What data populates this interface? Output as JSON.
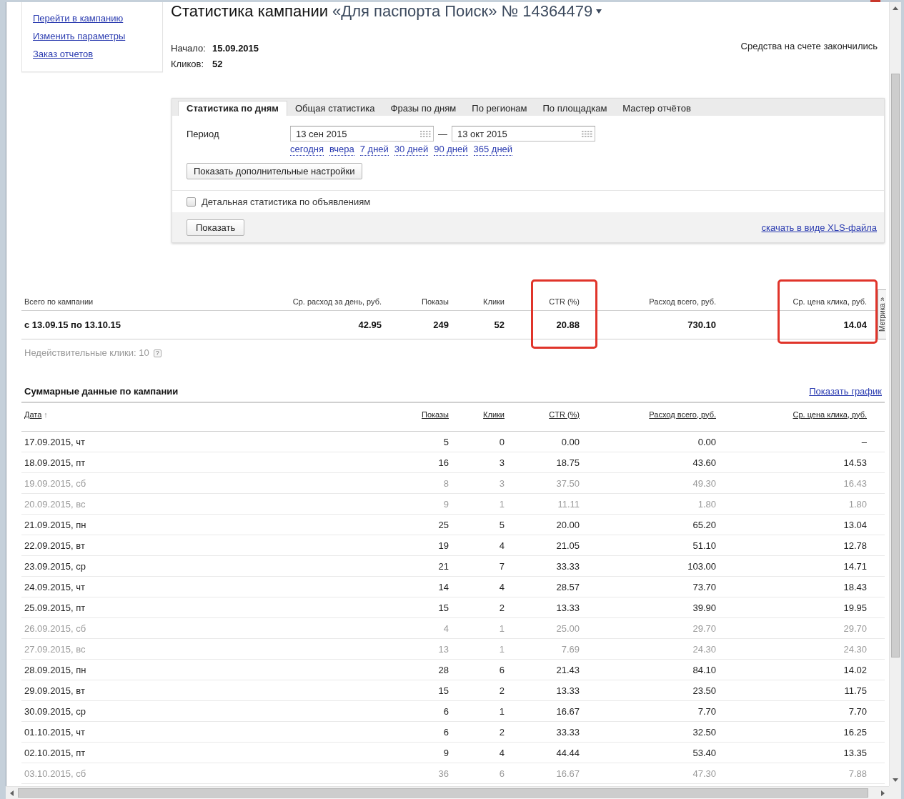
{
  "sidebar": {
    "links": [
      "Перейти в кампанию",
      "Изменить параметры",
      "Заказ отчетов"
    ]
  },
  "header": {
    "title": "Статистика кампании",
    "campaign": "«Для паспорта Поиск» № 14364479",
    "info": [
      {
        "label": "Начало:",
        "value": "15.09.2015"
      },
      {
        "label": "Кликов:",
        "value": "52"
      }
    ],
    "notice": "Средства на счете закончились"
  },
  "filter": {
    "tabs": [
      {
        "label": "Статистика по дням",
        "selected": true
      },
      {
        "label": "Общая статистика",
        "selected": false
      },
      {
        "label": "Фразы по дням",
        "selected": false
      },
      {
        "label": "По регионам",
        "selected": false
      },
      {
        "label": "По площадкам",
        "selected": false
      },
      {
        "label": "Мастер отчётов",
        "selected": false
      }
    ],
    "period_label": "Период",
    "date_from": "13 сен 2015",
    "separator": "—",
    "date_to": "13 окт 2015",
    "presets": [
      "сегодня",
      "вчера",
      "7 дней",
      "30 дней",
      "90 дней",
      "365 дней"
    ],
    "more_settings_button": "Показать дополнительные настройки",
    "detail_checkbox": {
      "label": "Детальная статистика по объявлениям",
      "checked": false
    },
    "show_button": "Показать",
    "download_link": "скачать в виде XLS-файла"
  },
  "summary": {
    "columns": [
      {
        "label": "Всего по кампании",
        "value": "с 13.09.15 по 13.10.15",
        "highlighted": false
      },
      {
        "label": "Ср. расход за день, руб.",
        "value": "42.95",
        "highlighted": false
      },
      {
        "label": "Показы",
        "value": "249",
        "highlighted": false
      },
      {
        "label": "Клики",
        "value": "52",
        "highlighted": false
      },
      {
        "label": "CTR (%)",
        "value": "20.88",
        "highlighted": true
      },
      {
        "label": "Расход всего, руб.",
        "value": "730.10",
        "highlighted": false
      },
      {
        "label": "Ср. цена клика, руб.",
        "value": "14.04",
        "highlighted": true
      }
    ],
    "side_tab": "Метрика »",
    "invalid_clicks": {
      "text": "Недействительные клики: 10",
      "help": "?"
    }
  },
  "daily": {
    "title": "Суммарные данные по кампании",
    "chart_link": "Показать график",
    "columns": [
      {
        "label": "Дата",
        "sort_arrow": "↑"
      },
      {
        "label": "Показы"
      },
      {
        "label": "Клики"
      },
      {
        "label": "CTR (%)"
      },
      {
        "label": "Расход всего, руб."
      },
      {
        "label": "Ср. цена клика, руб."
      }
    ],
    "rows": [
      {
        "cells": [
          "17.09.2015, чт",
          "5",
          "0",
          "0.00",
          "0.00",
          "–"
        ],
        "dimmed": false
      },
      {
        "cells": [
          "18.09.2015, пт",
          "16",
          "3",
          "18.75",
          "43.60",
          "14.53"
        ],
        "dimmed": false
      },
      {
        "cells": [
          "19.09.2015, сб",
          "8",
          "3",
          "37.50",
          "49.30",
          "16.43"
        ],
        "dimmed": true
      },
      {
        "cells": [
          "20.09.2015, вс",
          "9",
          "1",
          "11.11",
          "1.80",
          "1.80"
        ],
        "dimmed": true
      },
      {
        "cells": [
          "21.09.2015, пн",
          "25",
          "5",
          "20.00",
          "65.20",
          "13.04"
        ],
        "dimmed": false
      },
      {
        "cells": [
          "22.09.2015, вт",
          "19",
          "4",
          "21.05",
          "51.10",
          "12.78"
        ],
        "dimmed": false
      },
      {
        "cells": [
          "23.09.2015, ср",
          "21",
          "7",
          "33.33",
          "103.00",
          "14.71"
        ],
        "dimmed": false
      },
      {
        "cells": [
          "24.09.2015, чт",
          "14",
          "4",
          "28.57",
          "73.70",
          "18.43"
        ],
        "dimmed": false
      },
      {
        "cells": [
          "25.09.2015, пт",
          "15",
          "2",
          "13.33",
          "39.90",
          "19.95"
        ],
        "dimmed": false
      },
      {
        "cells": [
          "26.09.2015, сб",
          "4",
          "1",
          "25.00",
          "29.70",
          "29.70"
        ],
        "dimmed": true
      },
      {
        "cells": [
          "27.09.2015, вс",
          "13",
          "1",
          "7.69",
          "24.30",
          "24.30"
        ],
        "dimmed": true
      },
      {
        "cells": [
          "28.09.2015, пн",
          "28",
          "6",
          "21.43",
          "84.10",
          "14.02"
        ],
        "dimmed": false
      },
      {
        "cells": [
          "29.09.2015, вт",
          "15",
          "2",
          "13.33",
          "23.50",
          "11.75"
        ],
        "dimmed": false
      },
      {
        "cells": [
          "30.09.2015, ср",
          "6",
          "1",
          "16.67",
          "7.70",
          "7.70"
        ],
        "dimmed": false
      },
      {
        "cells": [
          "01.10.2015, чт",
          "6",
          "2",
          "33.33",
          "32.50",
          "16.25"
        ],
        "dimmed": false
      },
      {
        "cells": [
          "02.10.2015, пт",
          "9",
          "4",
          "44.44",
          "53.40",
          "13.35"
        ],
        "dimmed": false
      },
      {
        "cells": [
          "03.10.2015, сб",
          "36",
          "6",
          "16.67",
          "47.30",
          "7.88"
        ],
        "dimmed": true
      }
    ]
  }
}
